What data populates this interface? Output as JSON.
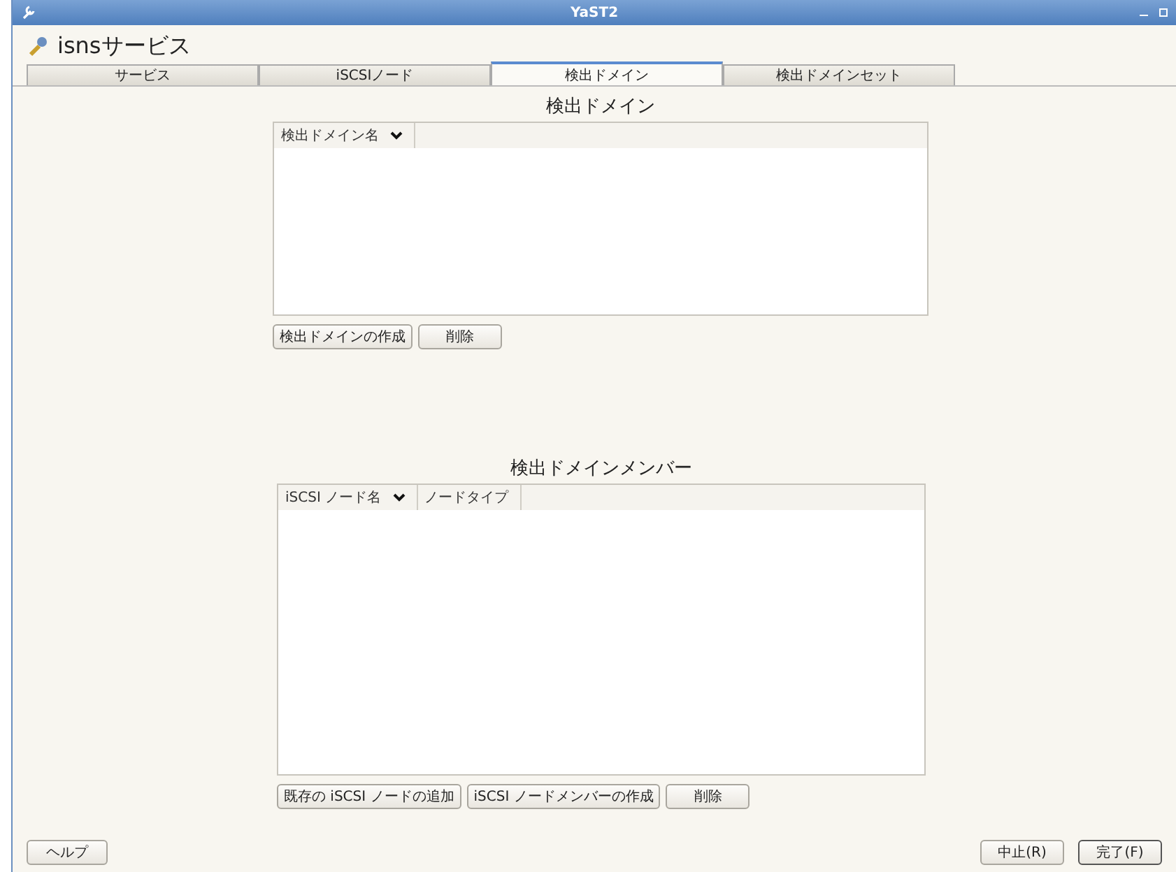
{
  "window": {
    "title": "YaST2"
  },
  "header": {
    "title": "isnsサービス"
  },
  "tabs": [
    {
      "label": "サービス",
      "selected": false
    },
    {
      "label": "iSCSIノード",
      "selected": false
    },
    {
      "label": "検出ドメイン",
      "selected": true
    },
    {
      "label": "検出ドメインセット",
      "selected": false
    }
  ],
  "domains": {
    "title": "検出ドメイン",
    "columns": [
      "検出ドメイン名"
    ],
    "buttons": [
      "検出ドメインの作成",
      "削除"
    ]
  },
  "members": {
    "title": "検出ドメインメンバー",
    "columns": [
      "iSCSI ノード名",
      "ノードタイプ"
    ],
    "buttons": [
      "既存の iSCSI ノードの追加",
      "iSCSI ノードメンバーの作成",
      "削除"
    ]
  },
  "footer": {
    "help": "ヘルプ",
    "cancel": "中止(R)",
    "finish": "完了(F)"
  }
}
